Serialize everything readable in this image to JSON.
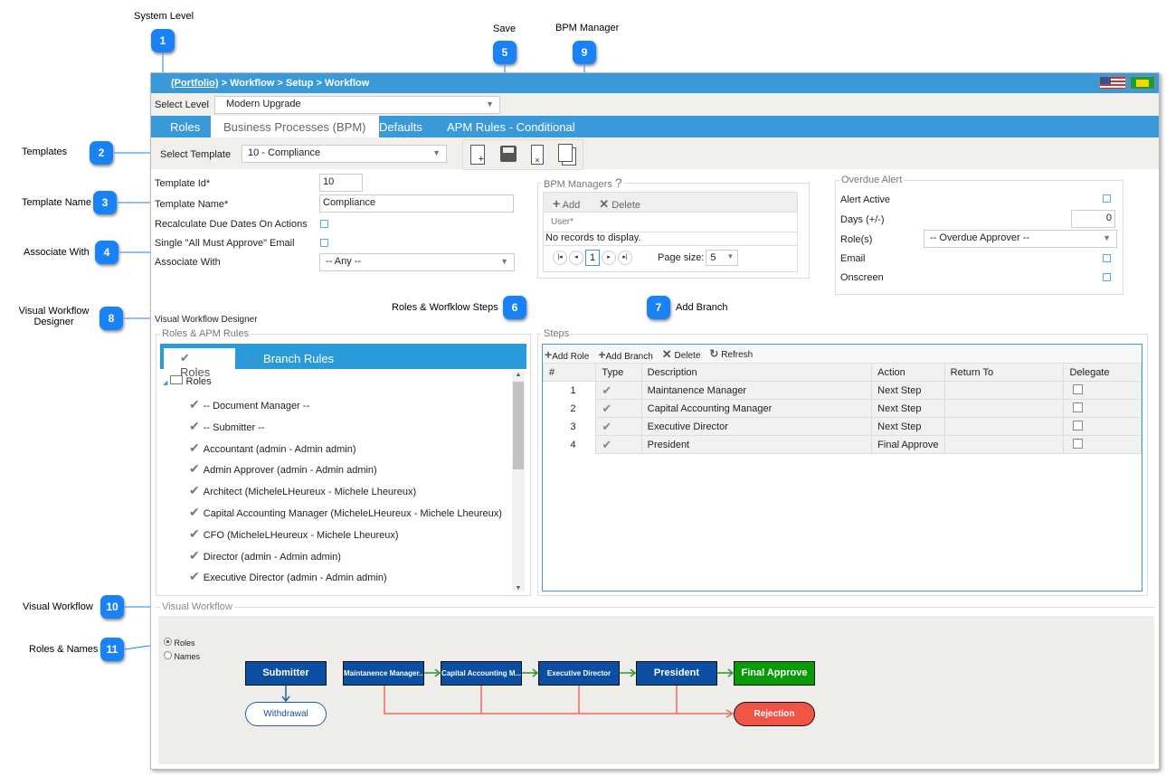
{
  "callouts": [
    {
      "n": "1",
      "label": "System Level"
    },
    {
      "n": "2",
      "label": "Templates"
    },
    {
      "n": "3",
      "label": "Template Name"
    },
    {
      "n": "4",
      "label": "Associate With"
    },
    {
      "n": "5",
      "label": "Save"
    },
    {
      "n": "6",
      "label": "Roles & Worfklow Steps"
    },
    {
      "n": "7",
      "label": "Add Branch"
    },
    {
      "n": "8",
      "label": "Visual Workflow Designer"
    },
    {
      "n": "9",
      "label": "BPM Manager"
    },
    {
      "n": "10",
      "label": "Visual Workflow"
    },
    {
      "n": "11",
      "label": "Roles & Names"
    }
  ],
  "breadcrumb": {
    "portfolio": "(Portfolio)",
    "rest": " > Workflow > Setup > Workflow"
  },
  "select_level": {
    "label": "Select Level",
    "value": "Modern Upgrade"
  },
  "tabs": [
    "Roles",
    "Business Processes (BPM)",
    "Defaults",
    "APM Rules - Conditional"
  ],
  "select_template": {
    "label": "Select Template",
    "value": "10 - Compliance"
  },
  "form": {
    "template_id_label": "Template Id*",
    "template_id": "10",
    "template_name_label": "Template Name*",
    "template_name": "Compliance",
    "recalc_label": "Recalculate Due Dates On Actions",
    "single_label": "Single \"All Must Approve\" Email",
    "associate_label": "Associate With",
    "associate_value": "-- Any --"
  },
  "bpm": {
    "legend": "BPM Managers",
    "help": "?",
    "add": "Add",
    "delete": "Delete",
    "col_user": "User*",
    "empty": "No records to display.",
    "page": "1",
    "page_size_label": "Page size:",
    "page_size": "5"
  },
  "overdue": {
    "legend": "Overdue Alert",
    "alert_active": "Alert Active",
    "days_label": "Days (+/-)",
    "days": "0",
    "roles_label": "Role(s)",
    "roles_value": "-- Overdue Approver --",
    "email": "Email",
    "onscreen": "Onscreen"
  },
  "designer": {
    "title": "Visual Workflow Designer",
    "legend": "Roles & APM Rules",
    "tab_roles": "Roles",
    "tab_branch": "Branch Rules",
    "root": "Roles",
    "roles": [
      "-- Document Manager --",
      "-- Submitter --",
      "Accountant (admin - Admin admin)",
      "Admin Approver (admin - Admin admin)",
      "Architect (MicheleLHeureux - Michele Lheureux)",
      "Capital Accounting Manager (MicheleLHeureux - Michele Lheureux)",
      "CFO (MicheleLHeureux - Michele Lheureux)",
      "Director (admin - Admin admin)",
      "Executive Director (admin - Admin admin)"
    ]
  },
  "steps": {
    "legend": "Steps",
    "add_role": "Add Role",
    "add_branch": "Add Branch",
    "delete": "Delete",
    "refresh": "Refresh",
    "columns": [
      "#",
      "Type",
      "Description",
      "Action",
      "Return To",
      "Delegate"
    ],
    "rows": [
      {
        "n": "1",
        "desc": "Maintanence Manager",
        "action": "Next Step",
        "return_to": ""
      },
      {
        "n": "2",
        "desc": "Capital Accounting Manager",
        "action": "Next Step",
        "return_to": ""
      },
      {
        "n": "3",
        "desc": "Executive Director",
        "action": "Next Step",
        "return_to": ""
      },
      {
        "n": "4",
        "desc": "President",
        "action": "Final Approve",
        "return_to": ""
      }
    ]
  },
  "visual": {
    "legend": "Visual Workflow",
    "radio_roles": "Roles",
    "radio_names": "Names",
    "selected": "Roles",
    "nodes": {
      "submitter": "Submitter",
      "withdrawal": "Withdrawal",
      "s1": "Maintanence Manager...",
      "s2": "Capital Accounting M...",
      "s3": "Executive Director",
      "s4": "President",
      "final": "Final Approve",
      "rejection": "Rejection"
    }
  },
  "colors": {
    "header": "#3a9ad9",
    "node": "#0b4ea2",
    "final": "#0a9a0a",
    "rejection": "#ef5445",
    "callout": "#1a82f7"
  }
}
